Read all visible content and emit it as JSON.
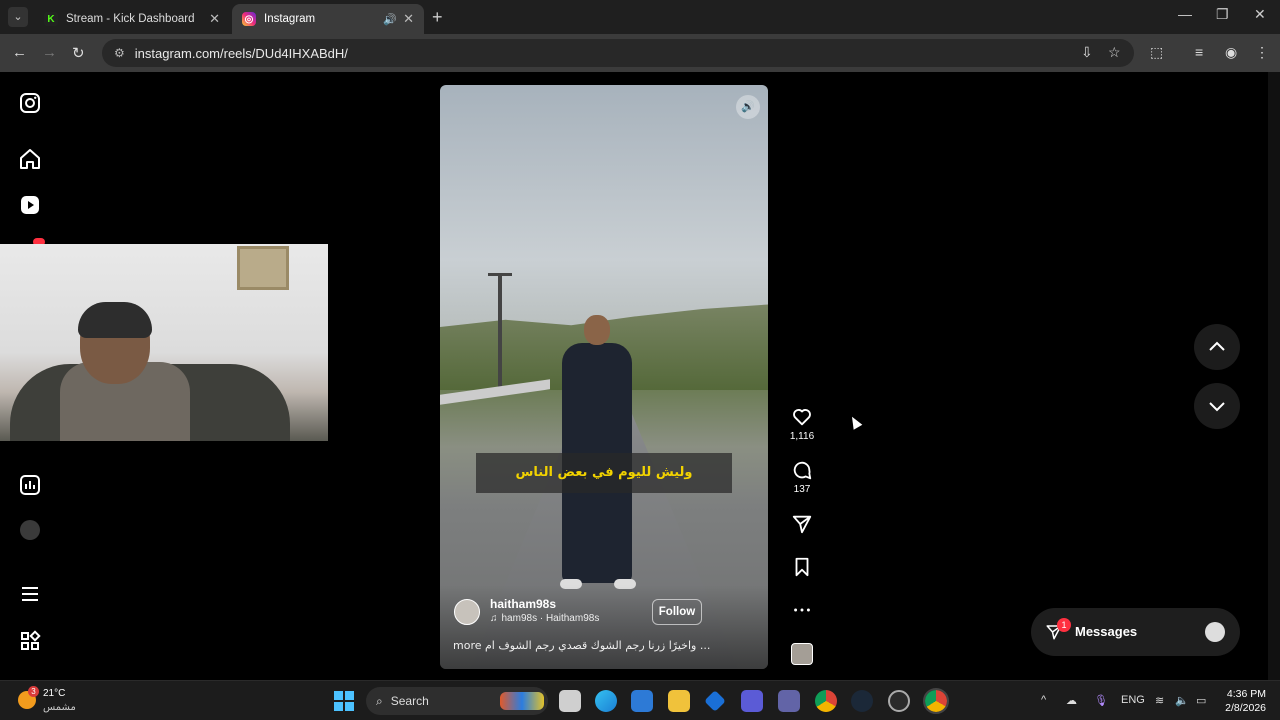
{
  "browser": {
    "tabs": [
      {
        "title": "Stream - Kick Dashboard",
        "favicon": "kick-icon",
        "active": false
      },
      {
        "title": "Instagram",
        "favicon": "instagram-icon",
        "active": true
      }
    ],
    "url": "instagram.com/reels/DUd4IHXABdH/"
  },
  "sidebar": {
    "icons": [
      "instagram-logo-icon",
      "home-icon",
      "reels-icon",
      "notifications-icon",
      "dashboard-icon",
      "profile-avatar",
      "menu-icon",
      "more-apps-icon"
    ]
  },
  "reel": {
    "caption_overlay": "وليش لليوم  في بعض الناس",
    "author": "haitham98s",
    "audio": "ham98s · Haitham98s",
    "follow_label": "Follow",
    "description": "واخيرًا زرنا رجم الشوك قصدي رجم الشوف ام ...",
    "more_label": "more",
    "likes": "1,116",
    "comments": "137"
  },
  "messages": {
    "label": "Messages",
    "badge": "1"
  },
  "taskbar": {
    "weather_badge": "3",
    "temperature": "21°C",
    "condition": "مشمس",
    "search_label": "Search",
    "language": "ENG",
    "time": "4:36 PM",
    "date": "2/8/2026"
  },
  "colors": {
    "accent_red": "#ff3040",
    "caption_yellow": "#f2d300",
    "chrome_dark": "#1f1f1f"
  }
}
